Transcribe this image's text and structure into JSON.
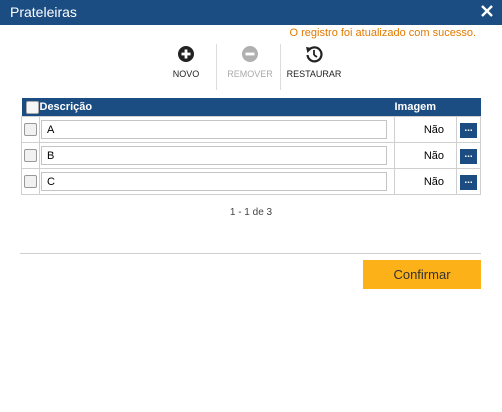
{
  "window": {
    "title": "Prateleiras"
  },
  "message": "O registro foi atualizado com sucesso.",
  "toolbar": {
    "new_label": "NOVO",
    "remove_label": "REMOVER",
    "restore_label": "RESTAURAR"
  },
  "grid": {
    "headers": {
      "description": "Descrição",
      "image": "Imagem"
    },
    "rows": [
      {
        "description": "A",
        "image": "Não",
        "action": "..."
      },
      {
        "description": "B",
        "image": "Não",
        "action": "..."
      },
      {
        "description": "C",
        "image": "Não",
        "action": "..."
      }
    ]
  },
  "pager": {
    "text": "1 - 1 de 3"
  },
  "confirm_label": "Confirmar",
  "colors": {
    "header": "#1b4d82",
    "message": "#e07a00",
    "confirm": "#fbb117"
  }
}
